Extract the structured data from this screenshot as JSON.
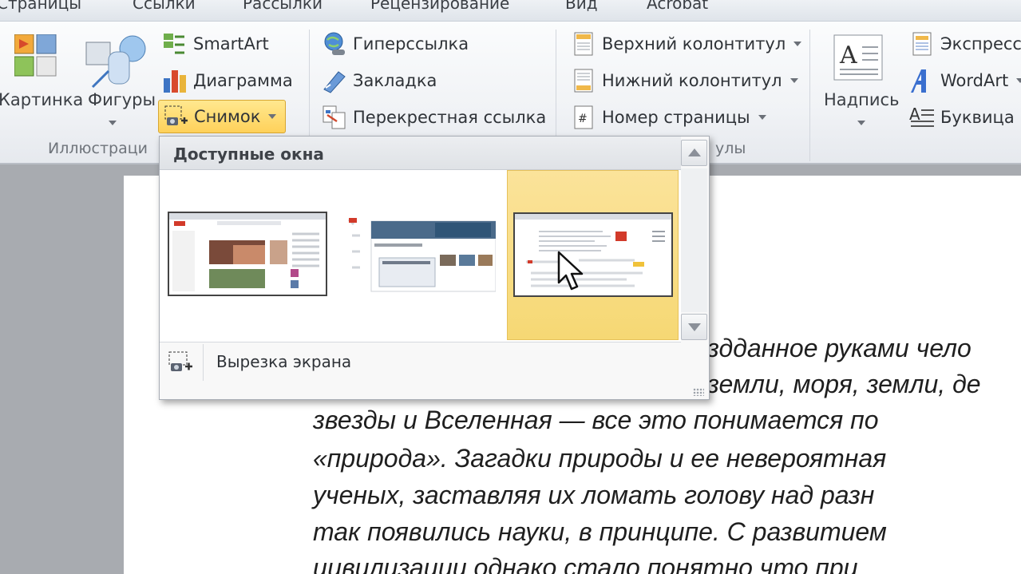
{
  "tabs": [
    "Страницы",
    "Ссылки",
    "Рассылки",
    "Рецензирование",
    "Вид",
    "Acrobat"
  ],
  "ribbon": {
    "illustrations": {
      "picture_label": "Картинка",
      "shapes_label": "Фигуры",
      "smartart_label": "SmartArt",
      "chart_label": "Диаграмма",
      "snapshot_label": "Снимок",
      "group_label": "Иллюстраци"
    },
    "links": {
      "hyperlink_label": "Гиперссылка",
      "bookmark_label": "Закладка",
      "crossref_label": "Перекрестная ссылка"
    },
    "header_footer": {
      "header_label": "Верхний колонтитул",
      "footer_label": "Нижний колонтитул",
      "page_number_label": "Номер страницы",
      "group_label": "улы"
    },
    "text": {
      "textbox_label": "Надпись",
      "express_label": "Экспресс",
      "wordart_label": "WordArt",
      "dropcap_label": "Буквица"
    }
  },
  "popup": {
    "title": "Доступные окна",
    "windows": [
      "window-1",
      "window-2",
      "window-3"
    ],
    "selected_index": 2,
    "screen_clipping_label": "Вырезка экрана"
  },
  "document": {
    "lines": [
      "здданное руками чело",
      "земли, моря, земли, де",
      "звезды и Вселенная — все это понимается по",
      "«природа». Загадки природы и ее невероятная",
      "ученых, заставляя их ломать голову над разн",
      "так появились науки, в принципе. С развитием",
      "цивилизации однако стало понятно что при"
    ]
  }
}
